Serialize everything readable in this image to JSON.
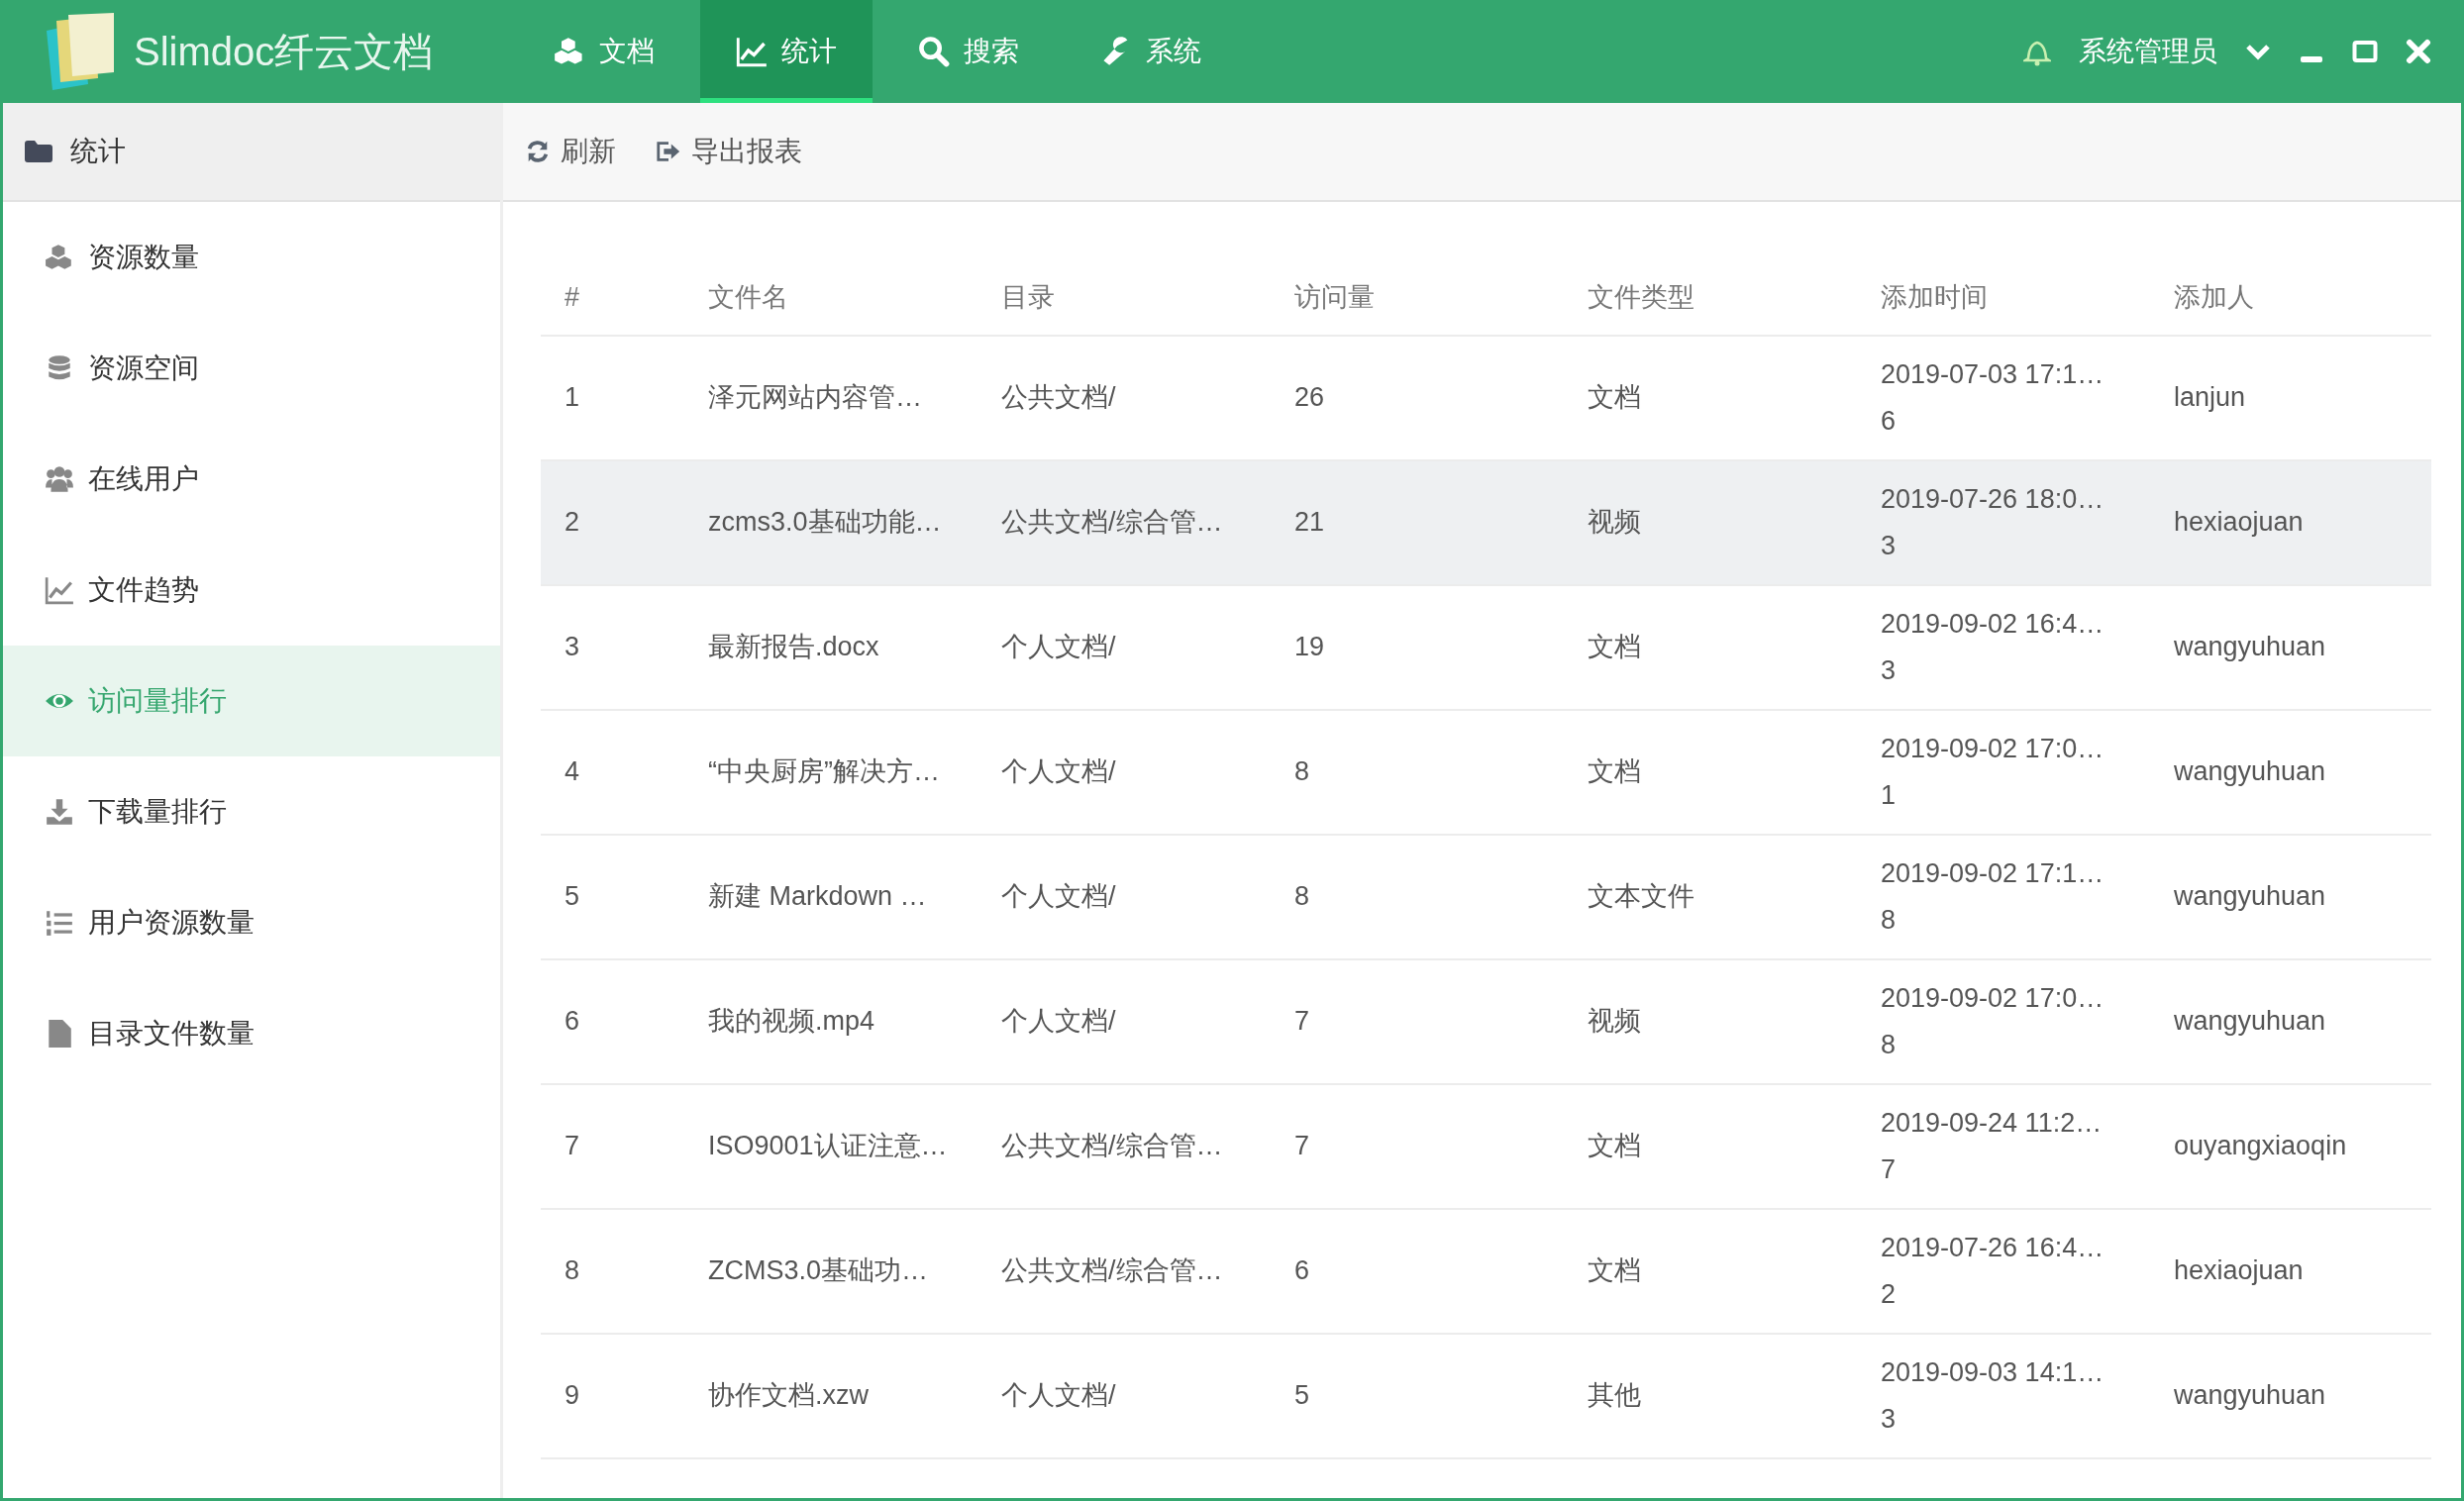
{
  "app": {
    "title": "Slimdoc纤云文档"
  },
  "nav": [
    {
      "label": "文档",
      "selected": false
    },
    {
      "label": "统计",
      "selected": true
    },
    {
      "label": "搜索",
      "selected": false
    },
    {
      "label": "系统",
      "selected": false
    }
  ],
  "user": {
    "name": "系统管理员"
  },
  "sidebar": {
    "title": "统计",
    "items": [
      {
        "label": "资源数量",
        "selected": false
      },
      {
        "label": "资源空间",
        "selected": false
      },
      {
        "label": "在线用户",
        "selected": false
      },
      {
        "label": "文件趋势",
        "selected": false
      },
      {
        "label": "访问量排行",
        "selected": true
      },
      {
        "label": "下载量排行",
        "selected": false
      },
      {
        "label": "用户资源数量",
        "selected": false
      },
      {
        "label": "目录文件数量",
        "selected": false
      }
    ]
  },
  "toolbar": [
    {
      "label": "刷新"
    },
    {
      "label": "导出报表"
    }
  ],
  "table": {
    "columns": [
      "#",
      "文件名",
      "目录",
      "访问量",
      "文件类型",
      "添加时间",
      "添加人"
    ],
    "rows": [
      {
        "cells": [
          "1",
          "泽元网站内容管…",
          "公共文档/",
          "26",
          "文档",
          [
            "2019-07-03 17:1…",
            "6"
          ],
          "lanjun"
        ],
        "hovered": false
      },
      {
        "cells": [
          "2",
          "zcms3.0基础功能…",
          "公共文档/综合管…",
          "21",
          "视频",
          [
            "2019-07-26 18:0…",
            "3"
          ],
          "hexiaojuan"
        ],
        "hovered": true
      },
      {
        "cells": [
          "3",
          "最新报告.docx",
          "个人文档/",
          "19",
          "文档",
          [
            "2019-09-02 16:4…",
            "3"
          ],
          "wangyuhuan"
        ],
        "hovered": false
      },
      {
        "cells": [
          "4",
          "“中央厨房”解决方…",
          "个人文档/",
          "8",
          "文档",
          [
            "2019-09-02 17:0…",
            "1"
          ],
          "wangyuhuan"
        ],
        "hovered": false
      },
      {
        "cells": [
          "5",
          "新建 Markdown …",
          "个人文档/",
          "8",
          "文本文件",
          [
            "2019-09-02 17:1…",
            "8"
          ],
          "wangyuhuan"
        ],
        "hovered": false
      },
      {
        "cells": [
          "6",
          "我的视频.mp4",
          "个人文档/",
          "7",
          "视频",
          [
            "2019-09-02 17:0…",
            "8"
          ],
          "wangyuhuan"
        ],
        "hovered": false
      },
      {
        "cells": [
          "7",
          "ISO9001认证注意…",
          "公共文档/综合管…",
          "7",
          "文档",
          [
            "2019-09-24 11:2…",
            "7"
          ],
          "ouyangxiaoqin"
        ],
        "hovered": false
      },
      {
        "cells": [
          "8",
          "ZCMS3.0基础功…",
          "公共文档/综合管…",
          "6",
          "文档",
          [
            "2019-07-26 16:4…",
            "2"
          ],
          "hexiaojuan"
        ],
        "hovered": false
      },
      {
        "cells": [
          "9",
          "协作文档.xzw",
          "个人文档/",
          "5",
          "其他",
          [
            "2019-09-03 14:1…",
            "3"
          ],
          "wangyuhuan"
        ],
        "hovered": false
      }
    ]
  }
}
